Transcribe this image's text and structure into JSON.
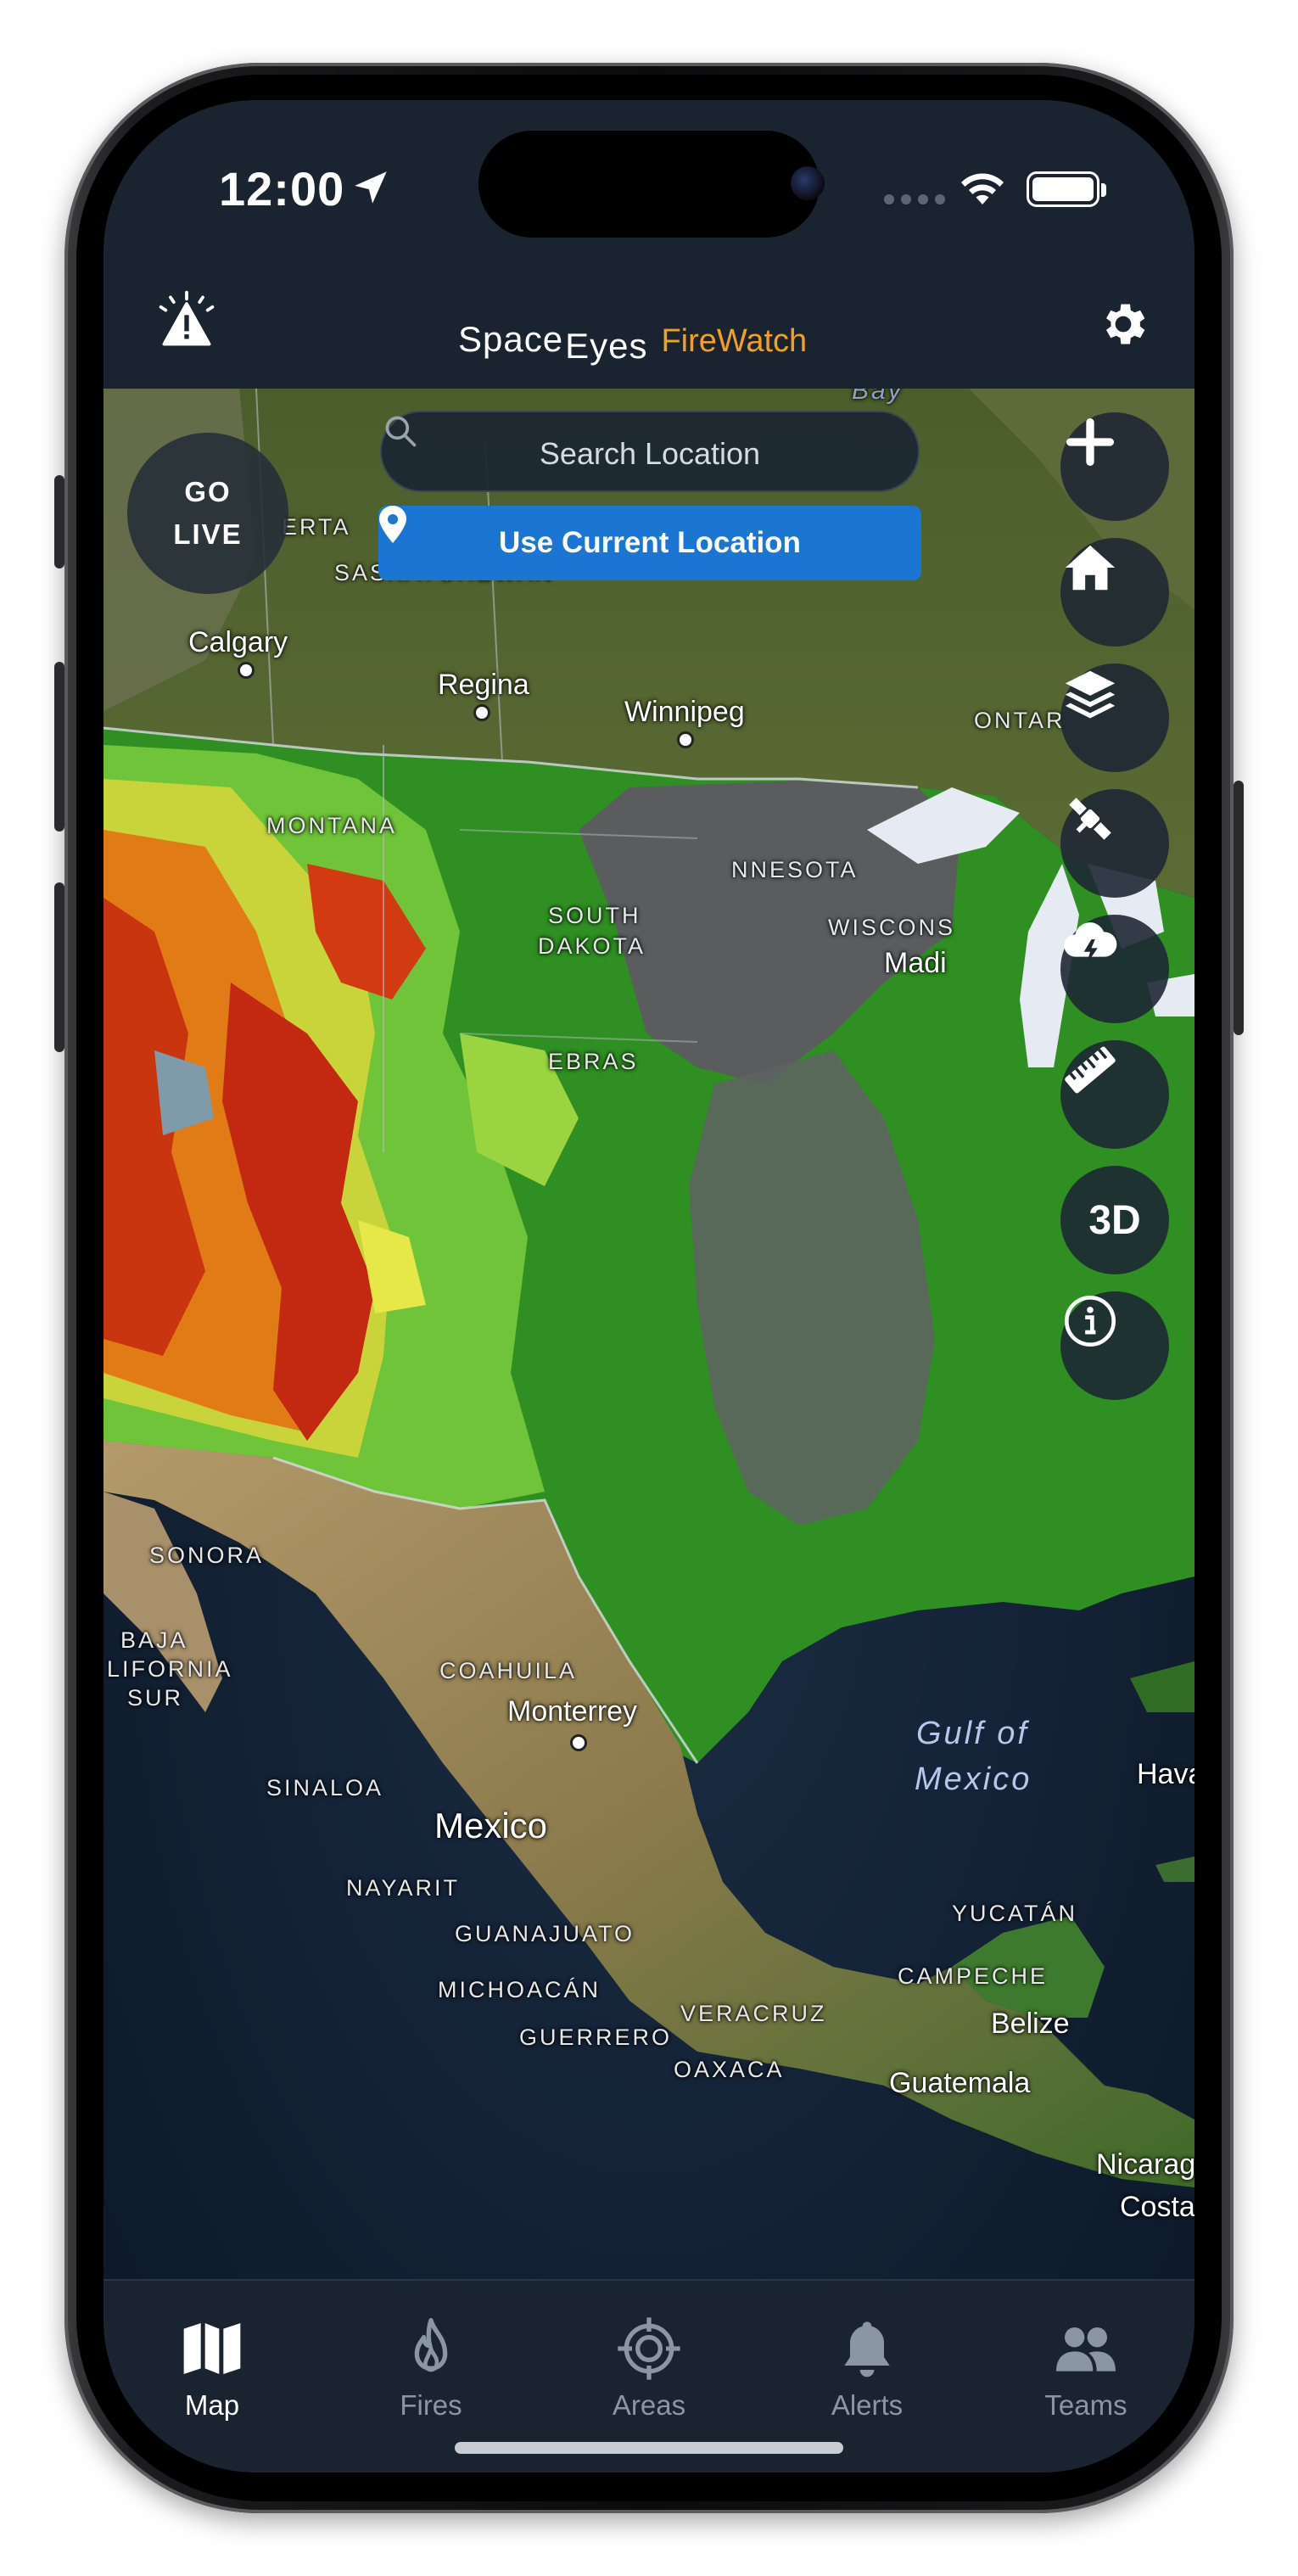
{
  "status_bar": {
    "time": "12:00"
  },
  "header": {
    "logo_space": "Space",
    "logo_eyes": "Eyes",
    "logo_product": "FireWatch",
    "accent_color": "#f2a11b"
  },
  "map_controls": {
    "go_live_line1": "GO",
    "go_live_line2": "LIVE",
    "search_placeholder": "Search Location",
    "use_current_location": "Use Current Location",
    "btn_3d": "3D",
    "tools": [
      "plus-icon",
      "home-icon",
      "layers-icon",
      "satellite-icon",
      "cloud-lightning-icon",
      "ruler-icon",
      "3d",
      "info-icon"
    ]
  },
  "map_labels": {
    "calgary": "Calgary",
    "regina": "Regina",
    "winnipeg": "Winnipeg",
    "saskatchewan": "SASKATCHEWAN",
    "erta": "ERTA",
    "ontario": "ONTAR",
    "montana": "MONTANA",
    "south_dakota_1": "SOUTH",
    "south_dakota_2": "DAKOTA",
    "minnesota": "NNESOTA",
    "wisconsin": "WISCONS",
    "madison": "Madi",
    "nebraska": "EBRAS",
    "sonora": "SONORA",
    "baja_1": "BAJA",
    "baja_2": "LIFORNIA",
    "baja_3": "SUR",
    "coahuila": "COAHUILA",
    "monterrey": "Monterrey",
    "sinaloa": "SINALOA",
    "mexico": "Mexico",
    "nayarit": "NAYARIT",
    "guanajuato": "GUANAJUATO",
    "michoacan": "MICHOACÁN",
    "guerrero": "GUERRERO",
    "veracruz": "VERACRUZ",
    "oaxaca": "OAXACA",
    "gulf_1": "Gulf of",
    "gulf_2": "Mexico",
    "havana": "Hava",
    "yucatan": "YUCATÁN",
    "campeche": "CAMPECHE",
    "belize": "Belize",
    "guatemala": "Guatemala",
    "nicaragua": "Nicarag",
    "costa_rica": "Costa",
    "bay": "Bay"
  },
  "tabs": [
    {
      "label": "Map",
      "icon": "map-icon",
      "active": true
    },
    {
      "label": "Fires",
      "icon": "flame-icon",
      "active": false
    },
    {
      "label": "Areas",
      "icon": "target-icon",
      "active": false
    },
    {
      "label": "Alerts",
      "icon": "bell-icon",
      "active": false
    },
    {
      "label": "Teams",
      "icon": "team-icon",
      "active": false
    }
  ]
}
